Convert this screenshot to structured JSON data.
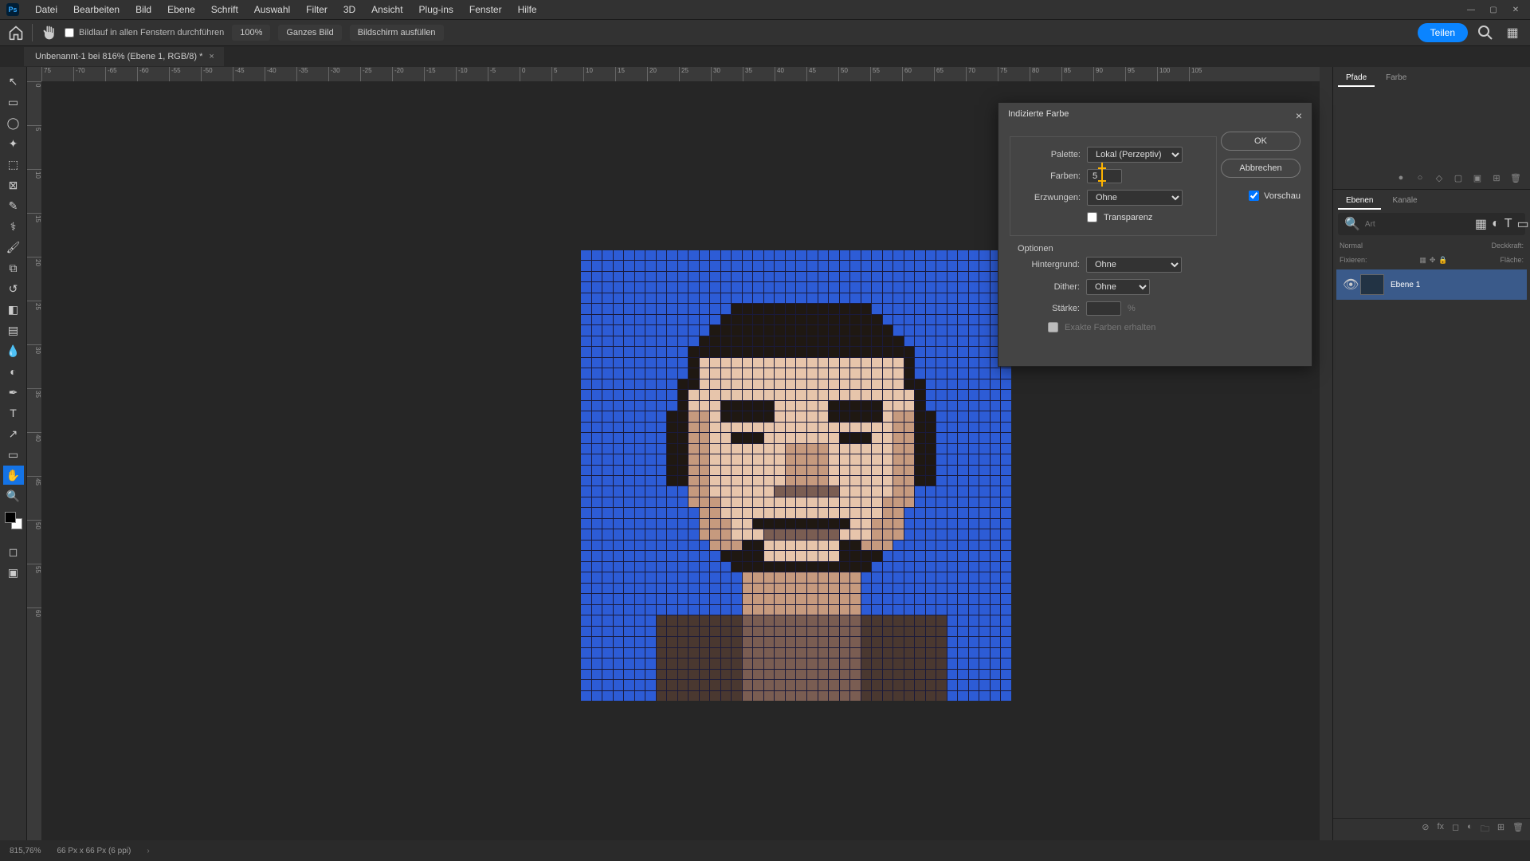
{
  "menu": [
    "Datei",
    "Bearbeiten",
    "Bild",
    "Ebene",
    "Schrift",
    "Auswahl",
    "Filter",
    "3D",
    "Ansicht",
    "Plug-ins",
    "Fenster",
    "Hilfe"
  ],
  "optbar": {
    "scroll_all": "Bildlauf in allen Fenstern durchführen",
    "zoom": "100%",
    "fit": "Ganzes Bild",
    "fill": "Bildschirm ausfüllen",
    "share": "Teilen"
  },
  "doc": {
    "tab": "Unbenannt-1 bei 816% (Ebene 1, RGB/8) *"
  },
  "ruler_h": [
    "75",
    "-70",
    "-65",
    "-60",
    "-55",
    "-50",
    "-45",
    "-40",
    "-35",
    "-30",
    "-25",
    "-20",
    "-15",
    "-10",
    "-5",
    "0",
    "5",
    "10",
    "15",
    "20",
    "25",
    "30",
    "35",
    "40",
    "45",
    "50",
    "55",
    "60",
    "65",
    "70",
    "75",
    "80",
    "85",
    "90",
    "95",
    "100",
    "105"
  ],
  "ruler_v": [
    "0",
    "5",
    "10",
    "15",
    "20",
    "25",
    "30",
    "35",
    "40",
    "45",
    "50",
    "55",
    "60"
  ],
  "panels": {
    "pfade": "Pfade",
    "farbe": "Farbe",
    "ebenen": "Ebenen",
    "kanale": "Kanäle",
    "search_ph": "Art",
    "blend": "Normal",
    "opacity_lbl": "Deckkraft:",
    "lock_lbl": "Fixieren:",
    "fill_lbl": "Fläche:",
    "layer_name": "Ebene 1"
  },
  "status": {
    "zoom": "815,76%",
    "dim": "66 Px x 66 Px (6 ppi)"
  },
  "dialog": {
    "title": "Indizierte Farbe",
    "palette_lbl": "Palette:",
    "palette_val": "Lokal (Perzeptiv)",
    "farben_lbl": "Farben:",
    "farben_val": "5",
    "erzw_lbl": "Erzwungen:",
    "erzw_val": "Ohne",
    "transp": "Transparenz",
    "optionen": "Optionen",
    "hint_lbl": "Hintergrund:",
    "hint_val": "Ohne",
    "dither_lbl": "Dither:",
    "dither_val": "Ohne",
    "starke_lbl": "Stärke:",
    "starke_unit": "%",
    "exact": "Exakte Farben erhalten",
    "ok": "OK",
    "cancel": "Abbrechen",
    "preview_lbl": "Vorschau"
  },
  "pixel_palette": [
    "#2d5cd6",
    "#1f1812",
    "#c69a7e",
    "#e7c5ab",
    "#7a5d52",
    "#4a3830"
  ]
}
